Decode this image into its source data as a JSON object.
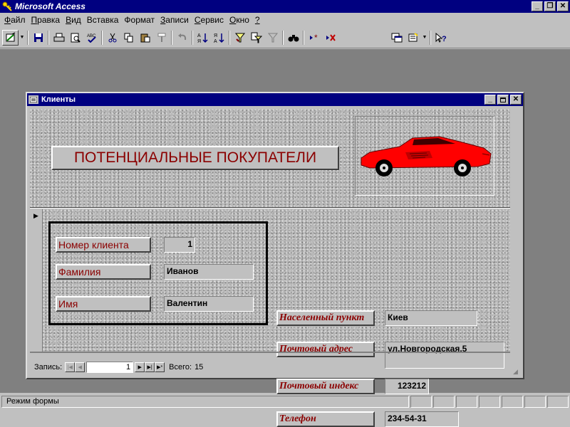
{
  "app": {
    "title": "Microsoft Access"
  },
  "title_buttons": {
    "minimize": "_",
    "restore": "❐",
    "close": "✕"
  },
  "menu": [
    {
      "label": "Файл",
      "accel": "Ф",
      "rest": "айл"
    },
    {
      "label": "Правка",
      "accel": "П",
      "rest": "равка"
    },
    {
      "label": "Вид",
      "accel": "В",
      "rest": "ид"
    },
    {
      "label": "Вставка",
      "accel": "",
      "rest": "Вставка"
    },
    {
      "label": "Формат",
      "accel": "",
      "rest": "Формат"
    },
    {
      "label": "Записи",
      "accel": "З",
      "rest": "аписи"
    },
    {
      "label": "Сервис",
      "accel": "С",
      "rest": "ервис"
    },
    {
      "label": "Окно",
      "accel": "О",
      "rest": "кно"
    },
    {
      "label": "?",
      "accel": "?",
      "rest": ""
    }
  ],
  "toolbar": {
    "icons": [
      "design-view-icon",
      "save-icon",
      "print-icon",
      "print-preview-icon",
      "spelling-icon",
      "cut-icon",
      "copy-icon",
      "paste-icon",
      "format-painter-icon",
      "undo-icon",
      "sort-ascending-icon",
      "sort-descending-icon",
      "filter-by-selection-icon",
      "filter-by-form-icon",
      "apply-filter-icon",
      "find-icon",
      "new-record-icon",
      "delete-record-icon",
      "database-window-icon",
      "new-object-icon",
      "help-icon"
    ]
  },
  "form": {
    "title": "Клиенты",
    "header_title": "ПОТЕНЦИАЛЬНЫЕ ПОКУПАТЕЛИ",
    "fields": {
      "client_number": {
        "label": "Номер клиента",
        "value": "1"
      },
      "last_name": {
        "label": "Фамилия",
        "value": "Иванов"
      },
      "first_name": {
        "label": "Имя",
        "value": "Валентин"
      },
      "city": {
        "label": "Населенный пункт",
        "value": "Киев"
      },
      "address": {
        "label": "Почтовый адрес",
        "value": "ул.Новгородская,5"
      },
      "zip": {
        "label": "Почтовый индекс",
        "value": "123212"
      },
      "phone": {
        "label": "Телефон",
        "value": "234-54-31"
      }
    },
    "nav": {
      "record_label": "Запись:",
      "current": "1",
      "total_label": "Всего:",
      "total": "15"
    }
  },
  "status": {
    "text": "Режим формы"
  }
}
